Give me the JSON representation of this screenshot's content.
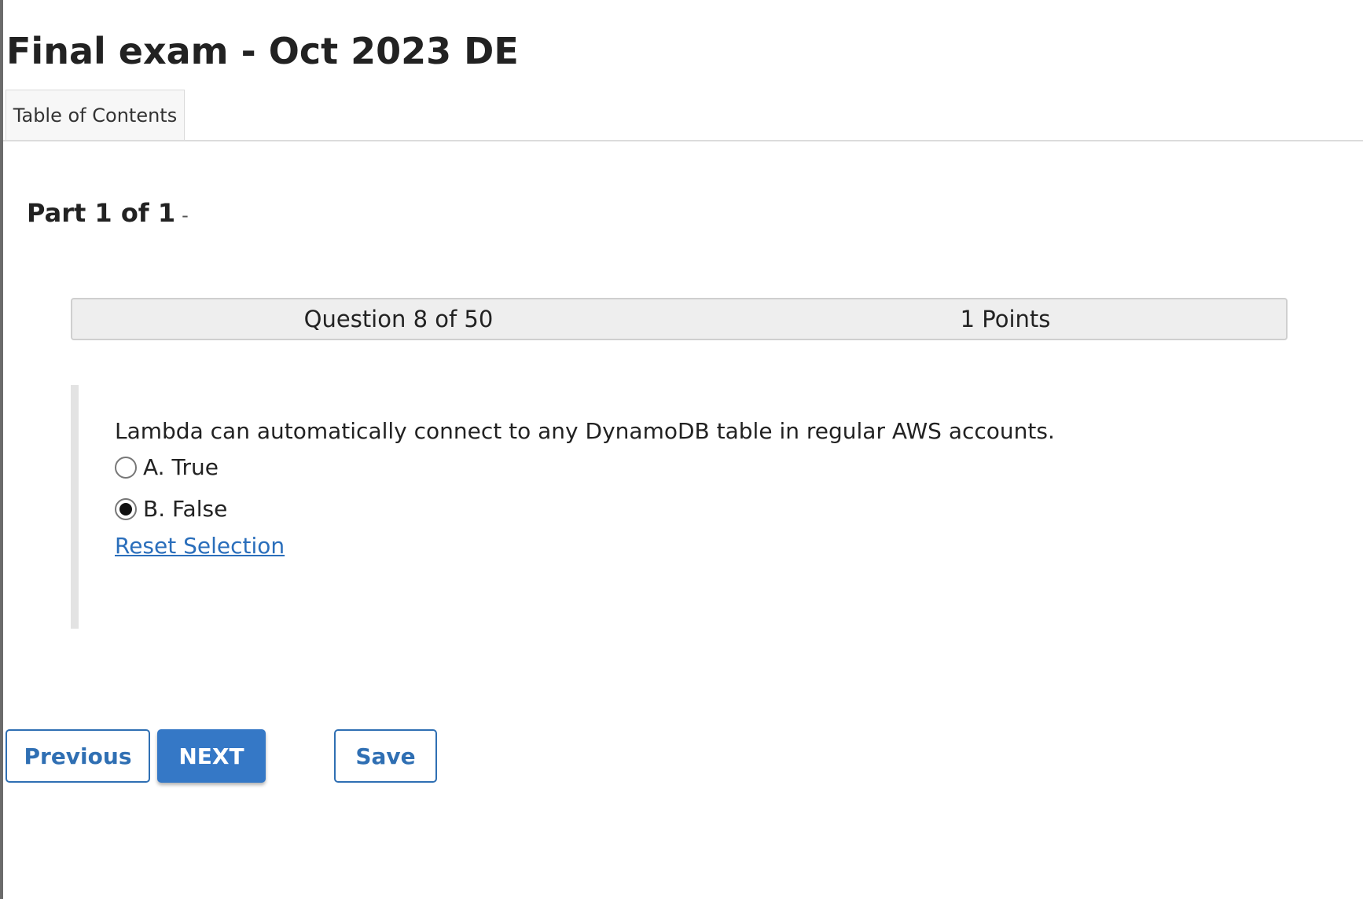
{
  "exam": {
    "title": "Final exam - Oct 2023 DE"
  },
  "tabs": {
    "toc_label": "Table of Contents"
  },
  "part": {
    "heading": "Part 1 of 1",
    "separator": "-"
  },
  "question": {
    "number_label": "Question 8 of 50",
    "points_label": "1 Points",
    "number": 8,
    "total": 50,
    "points": 1,
    "text": "Lambda can automatically connect to any DynamoDB table in regular AWS accounts.",
    "options": [
      {
        "label": "A. True",
        "selected": false
      },
      {
        "label": "B. False",
        "selected": true
      }
    ],
    "reset_label": "Reset Selection"
  },
  "navigation": {
    "previous_label": "Previous",
    "next_label": "NEXT",
    "save_label": "Save"
  },
  "colors": {
    "link": "#2a6ebb",
    "primary_button": "#3578c6",
    "outline_button": "#2f6fb3",
    "header_bg": "#eeeeee"
  }
}
